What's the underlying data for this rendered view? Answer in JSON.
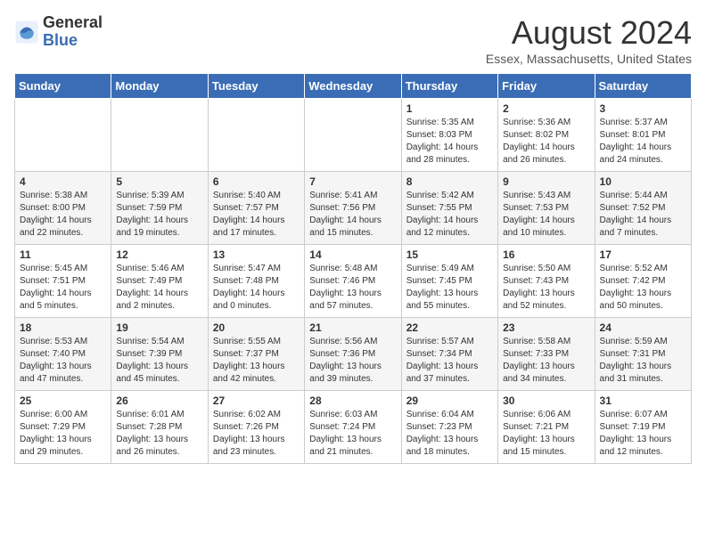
{
  "logo": {
    "line1": "General",
    "line2": "Blue"
  },
  "title": "August 2024",
  "subtitle": "Essex, Massachusetts, United States",
  "weekdays": [
    "Sunday",
    "Monday",
    "Tuesday",
    "Wednesday",
    "Thursday",
    "Friday",
    "Saturday"
  ],
  "weeks": [
    [
      {
        "day": "",
        "info": ""
      },
      {
        "day": "",
        "info": ""
      },
      {
        "day": "",
        "info": ""
      },
      {
        "day": "",
        "info": ""
      },
      {
        "day": "1",
        "info": "Sunrise: 5:35 AM\nSunset: 8:03 PM\nDaylight: 14 hours\nand 28 minutes."
      },
      {
        "day": "2",
        "info": "Sunrise: 5:36 AM\nSunset: 8:02 PM\nDaylight: 14 hours\nand 26 minutes."
      },
      {
        "day": "3",
        "info": "Sunrise: 5:37 AM\nSunset: 8:01 PM\nDaylight: 14 hours\nand 24 minutes."
      }
    ],
    [
      {
        "day": "4",
        "info": "Sunrise: 5:38 AM\nSunset: 8:00 PM\nDaylight: 14 hours\nand 22 minutes."
      },
      {
        "day": "5",
        "info": "Sunrise: 5:39 AM\nSunset: 7:59 PM\nDaylight: 14 hours\nand 19 minutes."
      },
      {
        "day": "6",
        "info": "Sunrise: 5:40 AM\nSunset: 7:57 PM\nDaylight: 14 hours\nand 17 minutes."
      },
      {
        "day": "7",
        "info": "Sunrise: 5:41 AM\nSunset: 7:56 PM\nDaylight: 14 hours\nand 15 minutes."
      },
      {
        "day": "8",
        "info": "Sunrise: 5:42 AM\nSunset: 7:55 PM\nDaylight: 14 hours\nand 12 minutes."
      },
      {
        "day": "9",
        "info": "Sunrise: 5:43 AM\nSunset: 7:53 PM\nDaylight: 14 hours\nand 10 minutes."
      },
      {
        "day": "10",
        "info": "Sunrise: 5:44 AM\nSunset: 7:52 PM\nDaylight: 14 hours\nand 7 minutes."
      }
    ],
    [
      {
        "day": "11",
        "info": "Sunrise: 5:45 AM\nSunset: 7:51 PM\nDaylight: 14 hours\nand 5 minutes."
      },
      {
        "day": "12",
        "info": "Sunrise: 5:46 AM\nSunset: 7:49 PM\nDaylight: 14 hours\nand 2 minutes."
      },
      {
        "day": "13",
        "info": "Sunrise: 5:47 AM\nSunset: 7:48 PM\nDaylight: 14 hours\nand 0 minutes."
      },
      {
        "day": "14",
        "info": "Sunrise: 5:48 AM\nSunset: 7:46 PM\nDaylight: 13 hours\nand 57 minutes."
      },
      {
        "day": "15",
        "info": "Sunrise: 5:49 AM\nSunset: 7:45 PM\nDaylight: 13 hours\nand 55 minutes."
      },
      {
        "day": "16",
        "info": "Sunrise: 5:50 AM\nSunset: 7:43 PM\nDaylight: 13 hours\nand 52 minutes."
      },
      {
        "day": "17",
        "info": "Sunrise: 5:52 AM\nSunset: 7:42 PM\nDaylight: 13 hours\nand 50 minutes."
      }
    ],
    [
      {
        "day": "18",
        "info": "Sunrise: 5:53 AM\nSunset: 7:40 PM\nDaylight: 13 hours\nand 47 minutes."
      },
      {
        "day": "19",
        "info": "Sunrise: 5:54 AM\nSunset: 7:39 PM\nDaylight: 13 hours\nand 45 minutes."
      },
      {
        "day": "20",
        "info": "Sunrise: 5:55 AM\nSunset: 7:37 PM\nDaylight: 13 hours\nand 42 minutes."
      },
      {
        "day": "21",
        "info": "Sunrise: 5:56 AM\nSunset: 7:36 PM\nDaylight: 13 hours\nand 39 minutes."
      },
      {
        "day": "22",
        "info": "Sunrise: 5:57 AM\nSunset: 7:34 PM\nDaylight: 13 hours\nand 37 minutes."
      },
      {
        "day": "23",
        "info": "Sunrise: 5:58 AM\nSunset: 7:33 PM\nDaylight: 13 hours\nand 34 minutes."
      },
      {
        "day": "24",
        "info": "Sunrise: 5:59 AM\nSunset: 7:31 PM\nDaylight: 13 hours\nand 31 minutes."
      }
    ],
    [
      {
        "day": "25",
        "info": "Sunrise: 6:00 AM\nSunset: 7:29 PM\nDaylight: 13 hours\nand 29 minutes."
      },
      {
        "day": "26",
        "info": "Sunrise: 6:01 AM\nSunset: 7:28 PM\nDaylight: 13 hours\nand 26 minutes."
      },
      {
        "day": "27",
        "info": "Sunrise: 6:02 AM\nSunset: 7:26 PM\nDaylight: 13 hours\nand 23 minutes."
      },
      {
        "day": "28",
        "info": "Sunrise: 6:03 AM\nSunset: 7:24 PM\nDaylight: 13 hours\nand 21 minutes."
      },
      {
        "day": "29",
        "info": "Sunrise: 6:04 AM\nSunset: 7:23 PM\nDaylight: 13 hours\nand 18 minutes."
      },
      {
        "day": "30",
        "info": "Sunrise: 6:06 AM\nSunset: 7:21 PM\nDaylight: 13 hours\nand 15 minutes."
      },
      {
        "day": "31",
        "info": "Sunrise: 6:07 AM\nSunset: 7:19 PM\nDaylight: 13 hours\nand 12 minutes."
      }
    ]
  ]
}
